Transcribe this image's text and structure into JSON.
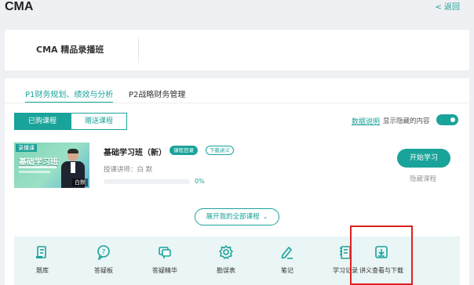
{
  "header": {
    "title": "CMA",
    "back_label": "< 返回"
  },
  "course": {
    "name": "CMA 精品录播班"
  },
  "tabs": [
    {
      "label": "P1财务规划、绩效与分析",
      "active": true
    },
    {
      "label": "P2战略财务管理",
      "active": false
    }
  ],
  "segments": [
    {
      "label": "已购课程",
      "active": true
    },
    {
      "label": "赠送课程",
      "active": false
    }
  ],
  "filters": {
    "data_link": "数据说明",
    "show_hidden": "显示隐藏的内容",
    "show_hidden_on": true
  },
  "lesson": {
    "thumb_tag": "录播课",
    "thumb_title": "基础学习班",
    "thumb_teacher": "白默",
    "title": "基础学习班（新）",
    "badge_catalog": "课程目录",
    "badge_download": "下载讲义",
    "lecturer": "授课讲师：白  默",
    "progress_text": "0%",
    "progress_value": 0,
    "start_label": "开始学习",
    "hide_label": "隐藏课程"
  },
  "expand": {
    "label": "展开我的全部课程"
  },
  "toolbar": {
    "items": [
      {
        "label": "题库",
        "icon": "question-bank-icon"
      },
      {
        "label": "答疑板",
        "icon": "qa-board-icon"
      },
      {
        "label": "答疑精华",
        "icon": "qa-highlights-icon"
      },
      {
        "label": "勘误表",
        "icon": "errata-icon"
      },
      {
        "label": "笔记",
        "icon": "notes-icon"
      },
      {
        "label": "学习记录",
        "icon": "study-record-icon"
      },
      {
        "label": "讲义查看与下载",
        "icon": "handout-download-icon"
      }
    ]
  },
  "colors": {
    "accent": "#1aa39a",
    "highlight": "#e02020"
  }
}
